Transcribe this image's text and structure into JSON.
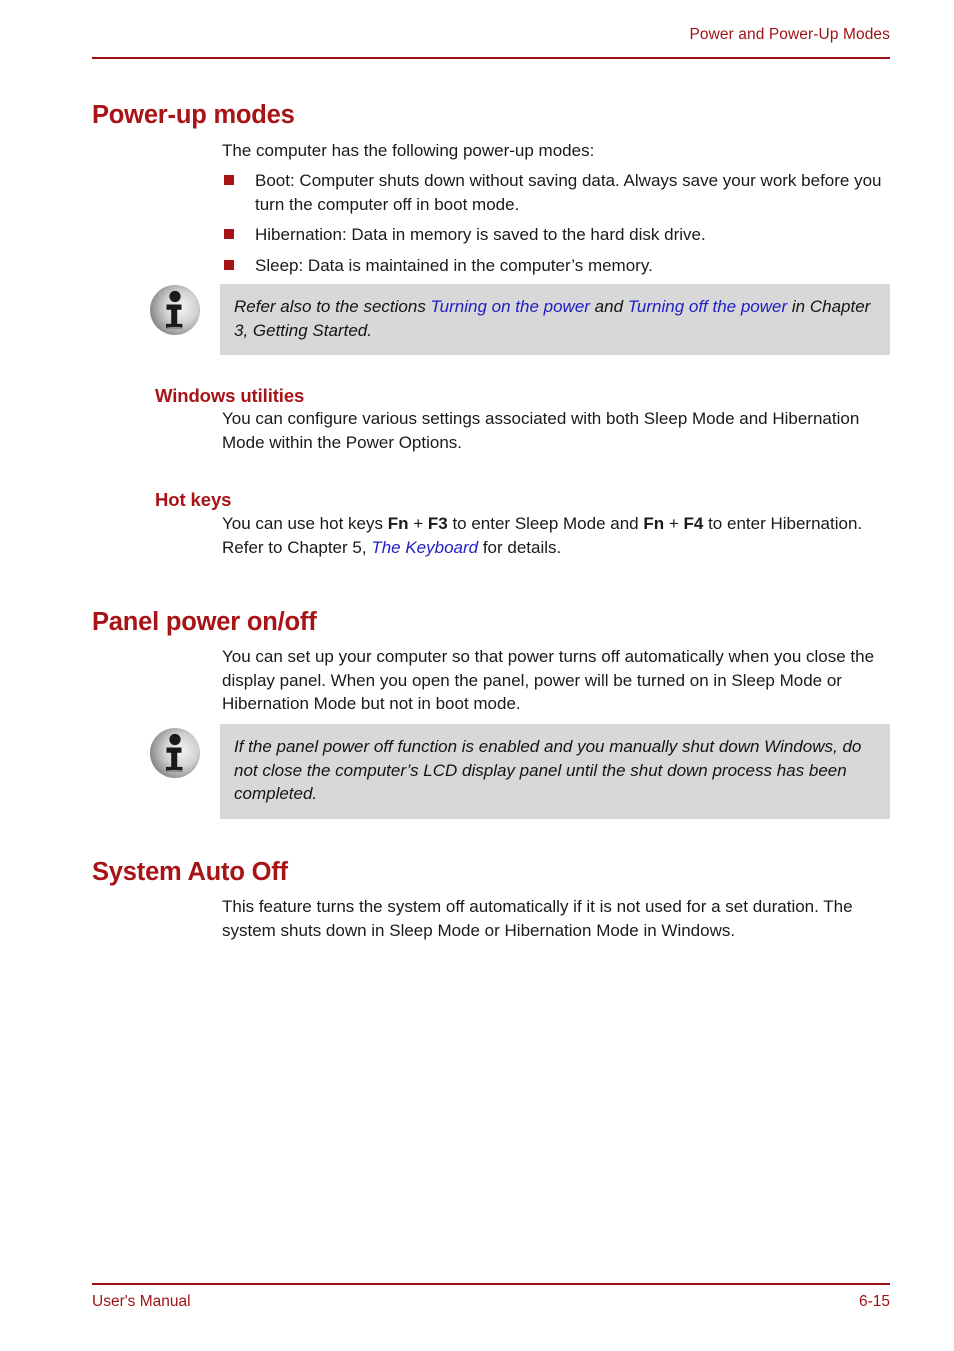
{
  "header": {
    "running_title": "Power and Power-Up Modes"
  },
  "footer": {
    "manual_label": "User's Manual",
    "page_number": "6-15"
  },
  "colors": {
    "heading_red": "#A81316",
    "rule_red": "#9E1114",
    "link_blue": "#1E1EC3",
    "note_background": "#D8D8D8",
    "body_text": "#1a1a1a"
  },
  "sections": {
    "power_up_modes": {
      "heading": "Power-up modes",
      "intro": "The computer has the following power-up modes:",
      "bullets": [
        "Boot: Computer shuts down without saving data. Always save your work before you turn the computer off in boot mode.",
        "Hibernation: Data in memory is saved to the hard disk drive.",
        "Sleep: Data is maintained in the computer’s memory."
      ],
      "note": {
        "icon": "info-icon",
        "text_part_1": "Refer also to the sections ",
        "link_1": "Turning on the power",
        "text_part_2": " and ",
        "link_2": "Turning off the power",
        "text_part_3": " in Chapter 3, Getting Started."
      }
    },
    "windows_utilities": {
      "heading": "Windows utilities",
      "body": "You can configure various settings associated with both Sleep Mode and Hibernation Mode within the Power Options."
    },
    "hot_keys": {
      "heading": "Hot keys",
      "text_part_1": "You can use hot keys ",
      "key_1": "Fn",
      "text_part_2": " + ",
      "key_2": "F3",
      "text_part_3": " to enter Sleep Mode and ",
      "key_3": "Fn",
      "text_part_4": " + ",
      "key_4": "F4",
      "text_part_5": " to enter Hibernation. Refer to Chapter 5, ",
      "link": "The Keyboard",
      "text_part_6": " for details."
    },
    "panel_power": {
      "heading": "Panel power on/off",
      "body": "You can set up your computer so that power turns off automatically when you close the display panel. When you open the panel, power will be turned on in Sleep Mode or Hibernation Mode but not in boot mode.",
      "note": {
        "icon": "info-icon",
        "text": "If the panel power off function is enabled and you manually shut down Windows, do not close the computer’s LCD display panel until the shut down process has been completed."
      }
    },
    "system_auto_off": {
      "heading": "System Auto Off",
      "body": "This feature turns the system off automatically if it is not used for a set duration. The system shuts down in Sleep Mode or Hibernation Mode in Windows."
    }
  }
}
